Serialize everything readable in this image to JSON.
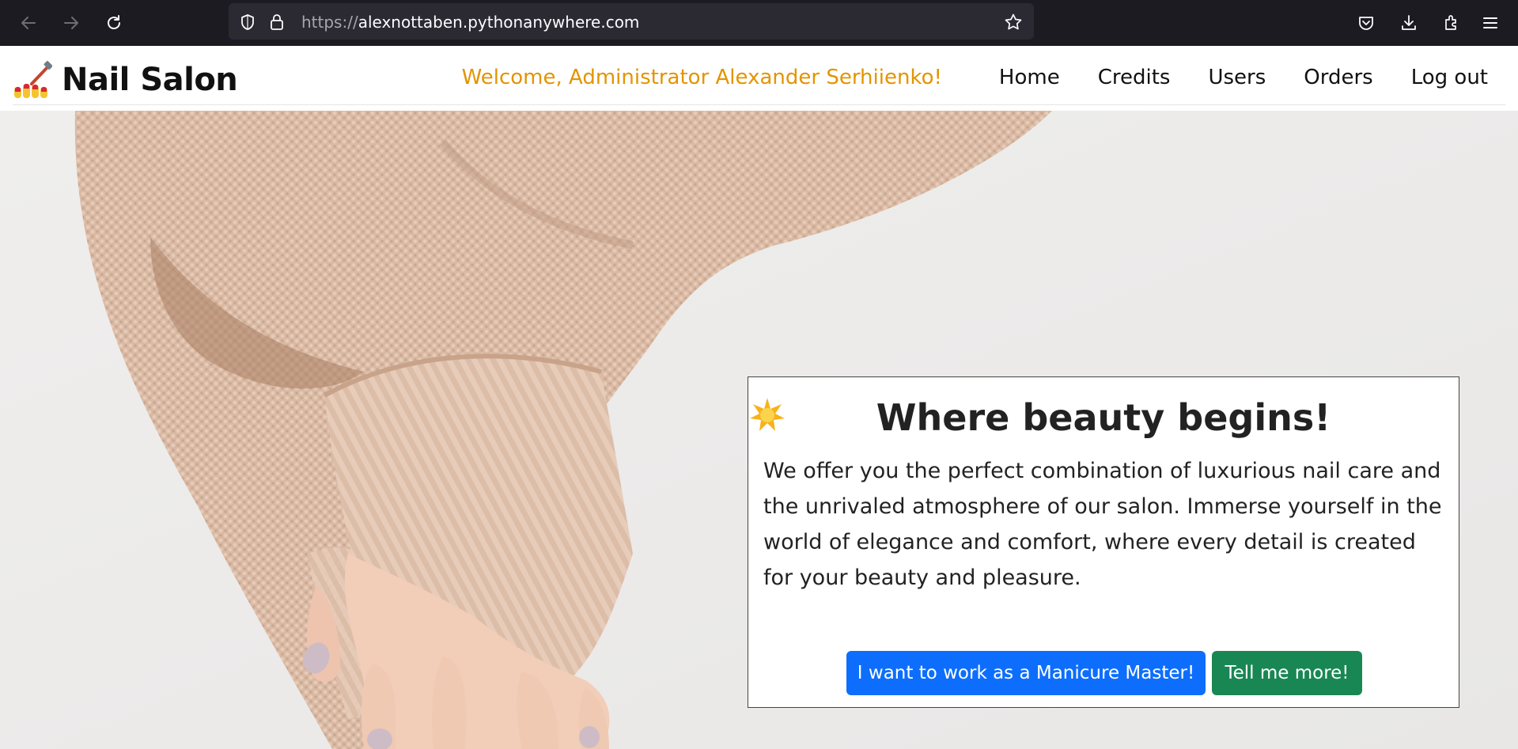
{
  "browser": {
    "url_protocol": "https://",
    "url_host": "alexnottaben.pythonanywhere.com",
    "icons": [
      "back-icon",
      "forward-icon",
      "reload-icon",
      "shield-icon",
      "lock-icon",
      "star-icon",
      "pocket-icon",
      "download-icon",
      "extensions-icon",
      "menu-icon"
    ]
  },
  "nav": {
    "brand": "Nail Salon",
    "welcome": "Welcome, Administrator Alexander Serhiienko!",
    "links": [
      "Home",
      "Credits",
      "Users",
      "Orders",
      "Log out"
    ]
  },
  "hero": {
    "title": "Where beauty begins!",
    "text": "We offer you the perfect combination of luxurious nail care and the unrivaled atmosphere of our salon. Immerse yourself in the world of elegance and comfort, where every detail is created for your beauty and pleasure.",
    "primary_button": "I want to work as a Manicure Master!",
    "secondary_button": "Tell me more!"
  },
  "colors": {
    "accent": "#e39400",
    "primary": "#0d6efd",
    "success": "#198754",
    "chrome_bg": "#1c1b22"
  }
}
